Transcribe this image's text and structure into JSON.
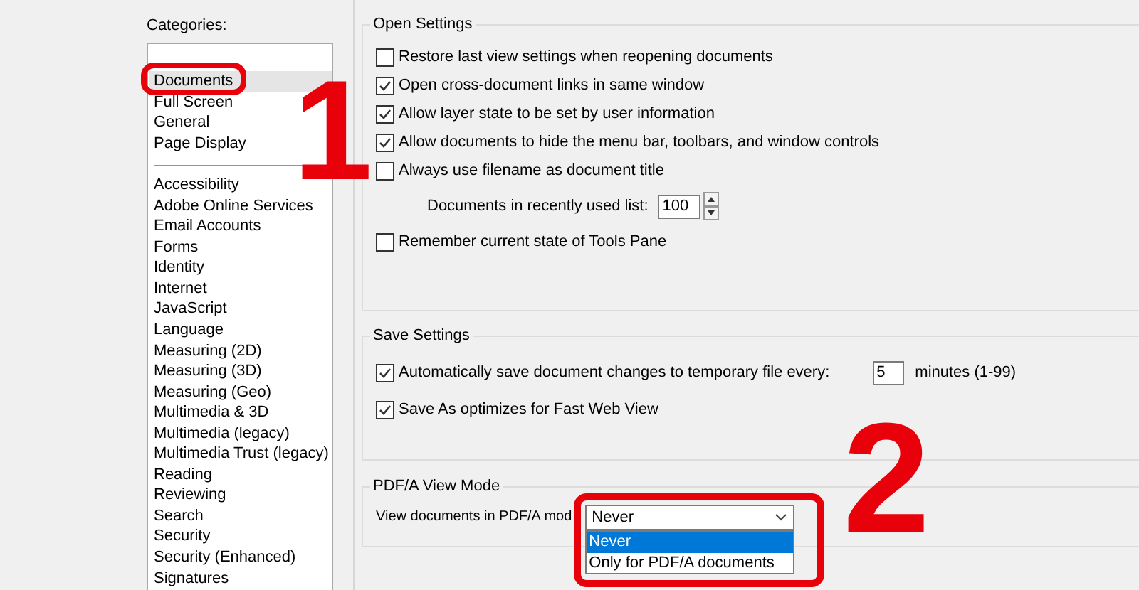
{
  "categories": {
    "label": "Categories:",
    "groups": [
      [
        {
          "label": "Documents",
          "selected": true
        },
        {
          "label": "Full Screen",
          "selected": false
        },
        {
          "label": "General",
          "selected": false
        },
        {
          "label": "Page Display",
          "selected": false
        }
      ],
      [
        {
          "label": "Accessibility",
          "selected": false
        },
        {
          "label": "Adobe Online Services",
          "selected": false
        },
        {
          "label": "Email Accounts",
          "selected": false
        },
        {
          "label": "Forms",
          "selected": false
        },
        {
          "label": "Identity",
          "selected": false
        },
        {
          "label": "Internet",
          "selected": false
        },
        {
          "label": "JavaScript",
          "selected": false
        },
        {
          "label": "Language",
          "selected": false
        },
        {
          "label": "Measuring (2D)",
          "selected": false
        },
        {
          "label": "Measuring (3D)",
          "selected": false
        },
        {
          "label": "Measuring (Geo)",
          "selected": false
        },
        {
          "label": "Multimedia & 3D",
          "selected": false
        },
        {
          "label": "Multimedia (legacy)",
          "selected": false
        },
        {
          "label": "Multimedia Trust (legacy)",
          "selected": false
        },
        {
          "label": "Reading",
          "selected": false
        },
        {
          "label": "Reviewing",
          "selected": false
        },
        {
          "label": "Search",
          "selected": false
        },
        {
          "label": "Security",
          "selected": false
        },
        {
          "label": "Security (Enhanced)",
          "selected": false
        },
        {
          "label": "Signatures",
          "selected": false
        }
      ]
    ]
  },
  "sections": [
    {
      "title": "Open Settings",
      "rows": [
        {
          "kind": "checkbox",
          "label": "Restore last view settings when reopening documents",
          "checked": false
        },
        {
          "kind": "checkbox",
          "label": "Open cross-document links in same window",
          "checked": true
        },
        {
          "kind": "checkbox",
          "label": "Allow layer state to be set by user information",
          "checked": true
        },
        {
          "kind": "checkbox",
          "label": "Allow documents to hide the menu bar, toolbars, and window controls",
          "checked": true
        },
        {
          "kind": "checkbox",
          "label": "Always use filename as document title",
          "checked": false
        },
        {
          "kind": "spinner",
          "label": "Documents in recently used list:",
          "value": "100"
        },
        {
          "kind": "checkbox",
          "label": "Remember current state of Tools Pane",
          "checked": false
        }
      ]
    },
    {
      "title": "Save Settings",
      "rows": [
        {
          "kind": "checkbox_number",
          "label": "Automatically save document changes to temporary file every:",
          "checked": true,
          "value": "5",
          "unit": "minutes (1-99)"
        },
        {
          "kind": "checkbox",
          "label": "Save As optimizes for Fast Web View",
          "checked": true
        }
      ]
    },
    {
      "title": "PDF/A View Mode",
      "rows": [
        {
          "kind": "dropdown",
          "label": "View documents in PDF/A mod",
          "value": "Never",
          "options": [
            {
              "label": "Never",
              "selected": true
            },
            {
              "label": "Only for PDF/A documents",
              "selected": false
            }
          ]
        }
      ]
    }
  ],
  "annotations": [
    {
      "label": "1"
    },
    {
      "label": "2"
    }
  ]
}
